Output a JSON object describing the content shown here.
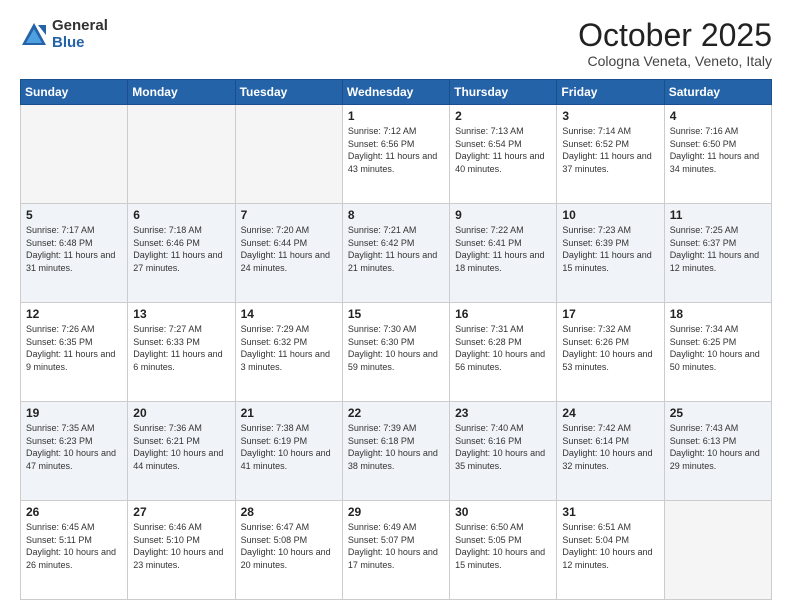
{
  "logo": {
    "general": "General",
    "blue": "Blue"
  },
  "header": {
    "month": "October 2025",
    "location": "Cologna Veneta, Veneto, Italy"
  },
  "days_of_week": [
    "Sunday",
    "Monday",
    "Tuesday",
    "Wednesday",
    "Thursday",
    "Friday",
    "Saturday"
  ],
  "weeks": [
    [
      {
        "day": "",
        "info": ""
      },
      {
        "day": "",
        "info": ""
      },
      {
        "day": "",
        "info": ""
      },
      {
        "day": "1",
        "info": "Sunrise: 7:12 AM\nSunset: 6:56 PM\nDaylight: 11 hours and 43 minutes."
      },
      {
        "day": "2",
        "info": "Sunrise: 7:13 AM\nSunset: 6:54 PM\nDaylight: 11 hours and 40 minutes."
      },
      {
        "day": "3",
        "info": "Sunrise: 7:14 AM\nSunset: 6:52 PM\nDaylight: 11 hours and 37 minutes."
      },
      {
        "day": "4",
        "info": "Sunrise: 7:16 AM\nSunset: 6:50 PM\nDaylight: 11 hours and 34 minutes."
      }
    ],
    [
      {
        "day": "5",
        "info": "Sunrise: 7:17 AM\nSunset: 6:48 PM\nDaylight: 11 hours and 31 minutes."
      },
      {
        "day": "6",
        "info": "Sunrise: 7:18 AM\nSunset: 6:46 PM\nDaylight: 11 hours and 27 minutes."
      },
      {
        "day": "7",
        "info": "Sunrise: 7:20 AM\nSunset: 6:44 PM\nDaylight: 11 hours and 24 minutes."
      },
      {
        "day": "8",
        "info": "Sunrise: 7:21 AM\nSunset: 6:42 PM\nDaylight: 11 hours and 21 minutes."
      },
      {
        "day": "9",
        "info": "Sunrise: 7:22 AM\nSunset: 6:41 PM\nDaylight: 11 hours and 18 minutes."
      },
      {
        "day": "10",
        "info": "Sunrise: 7:23 AM\nSunset: 6:39 PM\nDaylight: 11 hours and 15 minutes."
      },
      {
        "day": "11",
        "info": "Sunrise: 7:25 AM\nSunset: 6:37 PM\nDaylight: 11 hours and 12 minutes."
      }
    ],
    [
      {
        "day": "12",
        "info": "Sunrise: 7:26 AM\nSunset: 6:35 PM\nDaylight: 11 hours and 9 minutes."
      },
      {
        "day": "13",
        "info": "Sunrise: 7:27 AM\nSunset: 6:33 PM\nDaylight: 11 hours and 6 minutes."
      },
      {
        "day": "14",
        "info": "Sunrise: 7:29 AM\nSunset: 6:32 PM\nDaylight: 11 hours and 3 minutes."
      },
      {
        "day": "15",
        "info": "Sunrise: 7:30 AM\nSunset: 6:30 PM\nDaylight: 10 hours and 59 minutes."
      },
      {
        "day": "16",
        "info": "Sunrise: 7:31 AM\nSunset: 6:28 PM\nDaylight: 10 hours and 56 minutes."
      },
      {
        "day": "17",
        "info": "Sunrise: 7:32 AM\nSunset: 6:26 PM\nDaylight: 10 hours and 53 minutes."
      },
      {
        "day": "18",
        "info": "Sunrise: 7:34 AM\nSunset: 6:25 PM\nDaylight: 10 hours and 50 minutes."
      }
    ],
    [
      {
        "day": "19",
        "info": "Sunrise: 7:35 AM\nSunset: 6:23 PM\nDaylight: 10 hours and 47 minutes."
      },
      {
        "day": "20",
        "info": "Sunrise: 7:36 AM\nSunset: 6:21 PM\nDaylight: 10 hours and 44 minutes."
      },
      {
        "day": "21",
        "info": "Sunrise: 7:38 AM\nSunset: 6:19 PM\nDaylight: 10 hours and 41 minutes."
      },
      {
        "day": "22",
        "info": "Sunrise: 7:39 AM\nSunset: 6:18 PM\nDaylight: 10 hours and 38 minutes."
      },
      {
        "day": "23",
        "info": "Sunrise: 7:40 AM\nSunset: 6:16 PM\nDaylight: 10 hours and 35 minutes."
      },
      {
        "day": "24",
        "info": "Sunrise: 7:42 AM\nSunset: 6:14 PM\nDaylight: 10 hours and 32 minutes."
      },
      {
        "day": "25",
        "info": "Sunrise: 7:43 AM\nSunset: 6:13 PM\nDaylight: 10 hours and 29 minutes."
      }
    ],
    [
      {
        "day": "26",
        "info": "Sunrise: 6:45 AM\nSunset: 5:11 PM\nDaylight: 10 hours and 26 minutes."
      },
      {
        "day": "27",
        "info": "Sunrise: 6:46 AM\nSunset: 5:10 PM\nDaylight: 10 hours and 23 minutes."
      },
      {
        "day": "28",
        "info": "Sunrise: 6:47 AM\nSunset: 5:08 PM\nDaylight: 10 hours and 20 minutes."
      },
      {
        "day": "29",
        "info": "Sunrise: 6:49 AM\nSunset: 5:07 PM\nDaylight: 10 hours and 17 minutes."
      },
      {
        "day": "30",
        "info": "Sunrise: 6:50 AM\nSunset: 5:05 PM\nDaylight: 10 hours and 15 minutes."
      },
      {
        "day": "31",
        "info": "Sunrise: 6:51 AM\nSunset: 5:04 PM\nDaylight: 10 hours and 12 minutes."
      },
      {
        "day": "",
        "info": ""
      }
    ]
  ]
}
